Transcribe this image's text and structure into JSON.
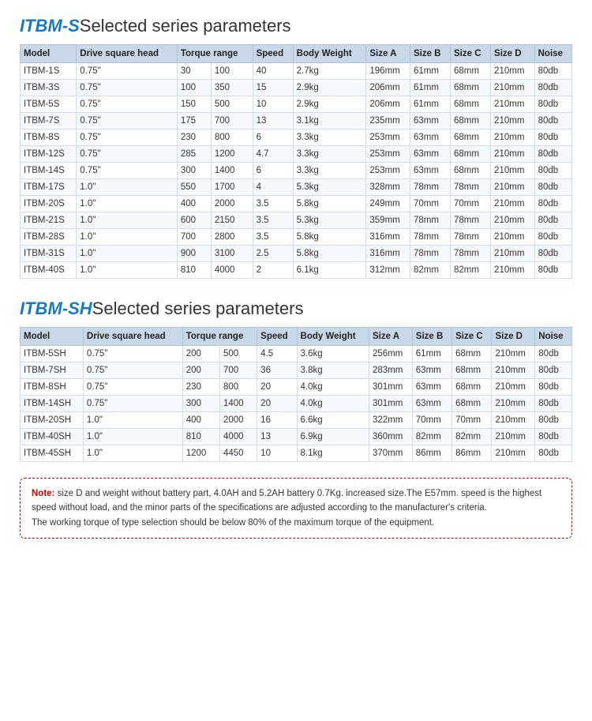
{
  "section1": {
    "brand": "ITBM-S",
    "title": "Selected series parameters",
    "headers": [
      "Model",
      "Drive square head",
      "Torque range",
      "",
      "Speed",
      "Body Weight",
      "Size A",
      "Size B",
      "Size C",
      "Size D",
      "Noise"
    ],
    "rows": [
      [
        "ITBM-1S",
        "0.75\"",
        "30",
        "100",
        "40",
        "2.7kg",
        "196mm",
        "61mm",
        "68mm",
        "210mm",
        "80db"
      ],
      [
        "ITBM-3S",
        "0.75\"",
        "100",
        "350",
        "15",
        "2.9kg",
        "206mm",
        "61mm",
        "68mm",
        "210mm",
        "80db"
      ],
      [
        "ITBM-5S",
        "0.75\"",
        "150",
        "500",
        "10",
        "2.9kg",
        "206mm",
        "61mm",
        "68mm",
        "210mm",
        "80db"
      ],
      [
        "ITBM-7S",
        "0.75\"",
        "175",
        "700",
        "13",
        "3.1kg",
        "235mm",
        "63mm",
        "68mm",
        "210mm",
        "80db"
      ],
      [
        "ITBM-8S",
        "0.75\"",
        "230",
        "800",
        "6",
        "3.3kg",
        "253mm",
        "63mm",
        "68mm",
        "210mm",
        "80db"
      ],
      [
        "ITBM-12S",
        "0.75\"",
        "285",
        "1200",
        "4.7",
        "3.3kg",
        "253mm",
        "63mm",
        "68mm",
        "210mm",
        "80db"
      ],
      [
        "ITBM-14S",
        "0.75\"",
        "300",
        "1400",
        "6",
        "3.3kg",
        "253mm",
        "63mm",
        "68mm",
        "210mm",
        "80db"
      ],
      [
        "ITBM-17S",
        "1.0\"",
        "550",
        "1700",
        "4",
        "5.3kg",
        "328mm",
        "78mm",
        "78mm",
        "210mm",
        "80db"
      ],
      [
        "ITBM-20S",
        "1.0\"",
        "400",
        "2000",
        "3.5",
        "5.8kg",
        "249mm",
        "70mm",
        "70mm",
        "210mm",
        "80db"
      ],
      [
        "ITBM-21S",
        "1.0\"",
        "600",
        "2150",
        "3.5",
        "5.3kg",
        "359mm",
        "78mm",
        "78mm",
        "210mm",
        "80db"
      ],
      [
        "ITBM-28S",
        "1.0\"",
        "700",
        "2800",
        "3.5",
        "5.8kg",
        "316mm",
        "78mm",
        "78mm",
        "210mm",
        "80db"
      ],
      [
        "ITBM-31S",
        "1.0\"",
        "900",
        "3100",
        "2.5",
        "5.8kg",
        "316mm",
        "78mm",
        "78mm",
        "210mm",
        "80db"
      ],
      [
        "ITBM-40S",
        "1.0\"",
        "810",
        "4000",
        "2",
        "6.1kg",
        "312mm",
        "82mm",
        "82mm",
        "210mm",
        "80db"
      ]
    ]
  },
  "section2": {
    "brand": "ITBM-SH",
    "title": "Selected series parameters",
    "headers": [
      "Model",
      "Drive square head",
      "Torque range",
      "",
      "Speed",
      "Body Weight",
      "Size A",
      "Size B",
      "Size C",
      "Size D",
      "Noise"
    ],
    "rows": [
      [
        "ITBM-5SH",
        "0.75\"",
        "200",
        "500",
        "4.5",
        "3.6kg",
        "256mm",
        "61mm",
        "68mm",
        "210mm",
        "80db"
      ],
      [
        "ITBM-7SH",
        "0.75\"",
        "200",
        "700",
        "36",
        "3.8kg",
        "283mm",
        "63mm",
        "68mm",
        "210mm",
        "80db"
      ],
      [
        "ITBM-8SH",
        "0.75\"",
        "230",
        "800",
        "20",
        "4.0kg",
        "301mm",
        "63mm",
        "68mm",
        "210mm",
        "80db"
      ],
      [
        "ITBM-14SH",
        "0.75\"",
        "300",
        "1400",
        "20",
        "4.0kg",
        "301mm",
        "63mm",
        "68mm",
        "210mm",
        "80db"
      ],
      [
        "ITBM-20SH",
        "1.0\"",
        "400",
        "2000",
        "16",
        "6.6kg",
        "322mm",
        "70mm",
        "70mm",
        "210mm",
        "80db"
      ],
      [
        "ITBM-40SH",
        "1.0\"",
        "810",
        "4000",
        "13",
        "6.9kg",
        "360mm",
        "82mm",
        "82mm",
        "210mm",
        "80db"
      ],
      [
        "ITBM-45SH",
        "1.0\"",
        "1200",
        "4450",
        "10",
        "8.1kg",
        "370mm",
        "86mm",
        "86mm",
        "210mm",
        "80db"
      ]
    ]
  },
  "note": {
    "label": "Note:",
    "text1": " size D and weight without battery part, 4.0AH and 5.2AH battery 0.7Kg. increased size.The E57mm. speed is the highest speed without load, and the minor parts of the specifications are adjusted according to the manufacturer's criteria.",
    "text2": "The working torque of type selection should be below 80% of the maximum torque of the equipment."
  },
  "col_headers": {
    "model": "Model",
    "drive_square_head": "Drive square head",
    "torque_range": "Torque range",
    "speed": "Speed",
    "body_weight": "Body Weight",
    "size_a": "Size A",
    "size_b": "Size B",
    "size_c": "Size C",
    "size_d": "Size D",
    "noise": "Noise"
  }
}
